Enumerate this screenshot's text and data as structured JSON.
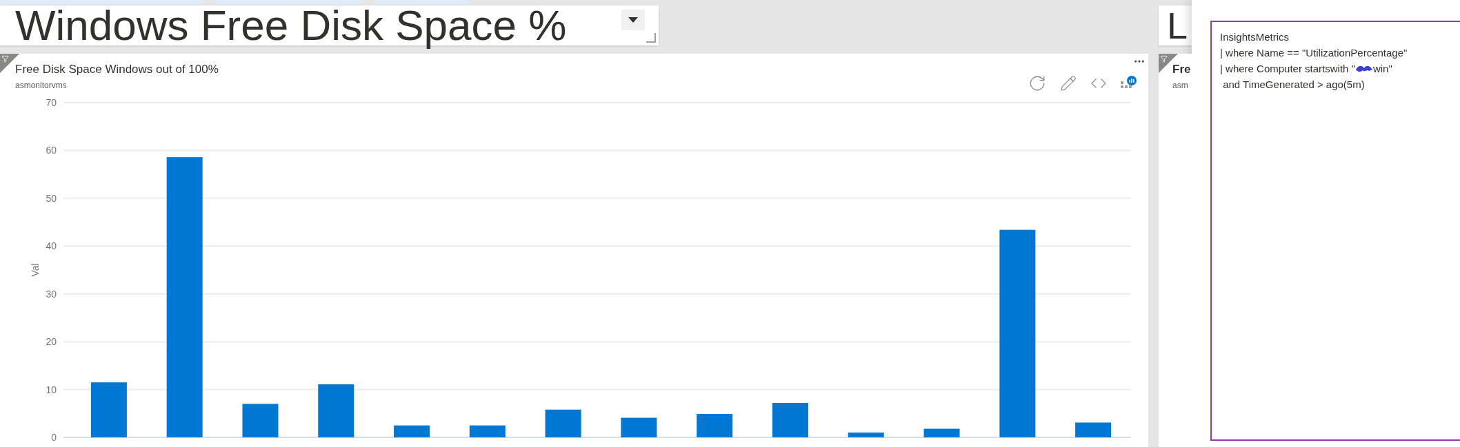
{
  "title_tile": {
    "title": "Windows Free Disk Space %"
  },
  "side_title_tile": {
    "title": "L"
  },
  "chart_tile": {
    "title": "Free Disk Space Windows out of 100%",
    "subtitle": "asmonitorvms",
    "chart_data": {
      "type": "bar",
      "ylabel": "Val",
      "ylim": [
        0,
        70
      ],
      "grid": true,
      "yticks": [
        0,
        10,
        20,
        30,
        40,
        50,
        60,
        70
      ],
      "series": [
        {
          "color": "#0078d4",
          "values": [
            11.5,
            58.6,
            7.0,
            11.1,
            2.5,
            2.5,
            5.8,
            4.1,
            4.9,
            7.2,
            1.0,
            1.8,
            43.4,
            3.1
          ]
        }
      ]
    }
  },
  "side_chart_tile": {
    "title": "Fre",
    "subtitle": "asm"
  },
  "query_panel": {
    "lines": [
      {
        "kind": "text",
        "text": "InsightsMetrics"
      },
      {
        "kind": "text",
        "text": "| where Name == \"UtilizationPercentage\""
      },
      {
        "kind": "redacted",
        "before": "| where Computer startswith \"",
        "after": "win\""
      },
      {
        "kind": "text",
        "text": " and TimeGenerated > ago(5m)"
      }
    ]
  }
}
